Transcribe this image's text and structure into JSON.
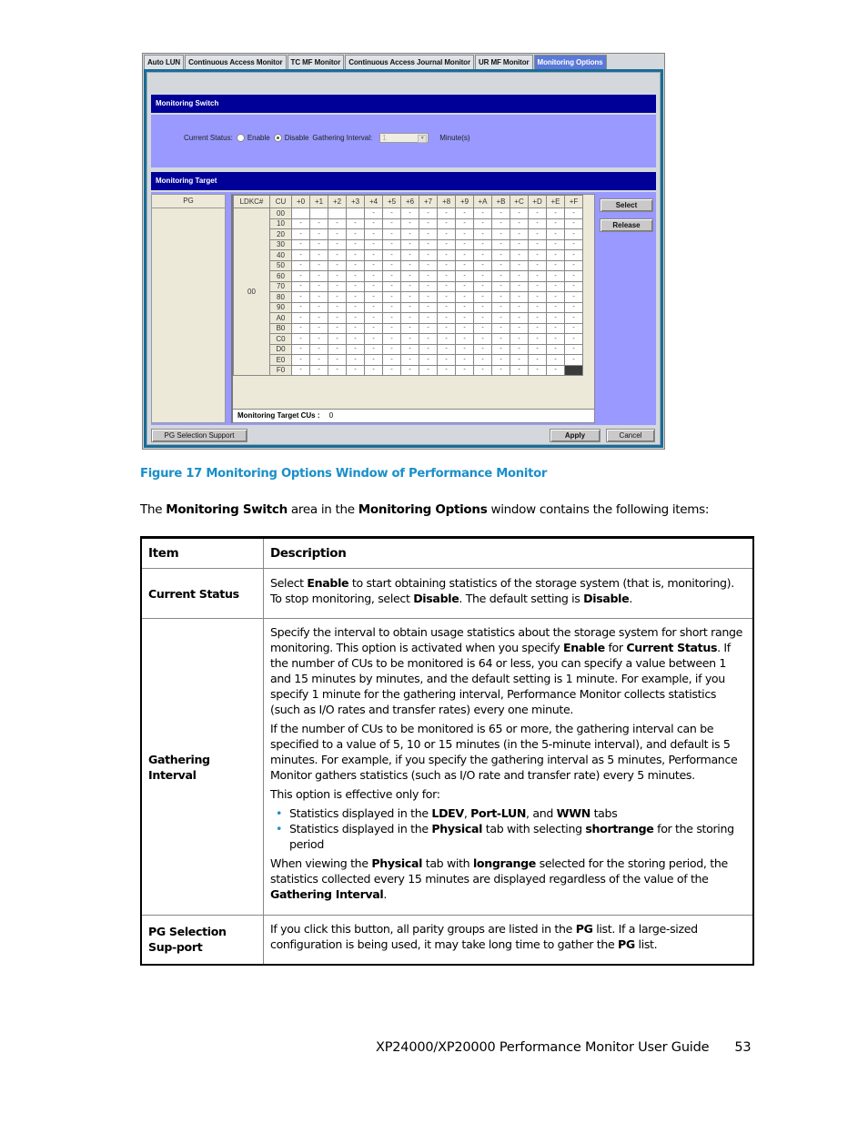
{
  "window": {
    "tabs": [
      {
        "label": "Auto LUN",
        "active": false
      },
      {
        "label": "Continuous Access Monitor",
        "active": false
      },
      {
        "label": "TC MF Monitor",
        "active": false
      },
      {
        "label": "Continuous Access Journal Monitor",
        "active": false
      },
      {
        "label": "UR MF Monitor",
        "active": false
      },
      {
        "label": "Monitoring Options",
        "active": true
      }
    ],
    "monitoring_switch": {
      "title": "Monitoring Switch",
      "current_status_label": "Current Status:",
      "enable_label": "Enable",
      "disable_label": "Disable",
      "selected": "Disable",
      "gathering_interval_label": "Gathering Interval:",
      "gathering_interval_value": "1",
      "minutes_label": "Minute(s)"
    },
    "monitoring_target": {
      "title": "Monitoring Target",
      "pg_header": "PG",
      "ldkc_header": "LDKC#",
      "cu_header": "CU",
      "ldkc_value": "00",
      "columns": [
        "+0",
        "+1",
        "+2",
        "+3",
        "+4",
        "+5",
        "+6",
        "+7",
        "+8",
        "+9",
        "+A",
        "+B",
        "+C",
        "+D",
        "+E",
        "+F"
      ],
      "rows": [
        {
          "cu": "00",
          "cells": [
            "",
            "",
            "",
            "",
            "-",
            "-",
            "-",
            "-",
            "-",
            "-",
            "-",
            "-",
            "-",
            "-",
            "-",
            "-"
          ]
        },
        {
          "cu": "10",
          "cells": [
            "-",
            "-",
            "-",
            "-",
            "-",
            "-",
            "-",
            "-",
            "-",
            "-",
            "-",
            "-",
            "-",
            "-",
            "-",
            "-"
          ]
        },
        {
          "cu": "20",
          "cells": [
            "-",
            "-",
            "-",
            "-",
            "-",
            "-",
            "-",
            "-",
            "-",
            "-",
            "-",
            "-",
            "-",
            "-",
            "-",
            "-"
          ]
        },
        {
          "cu": "30",
          "cells": [
            "-",
            "-",
            "-",
            "-",
            "-",
            "-",
            "-",
            "-",
            "-",
            "-",
            "-",
            "-",
            "-",
            "-",
            "-",
            "-"
          ]
        },
        {
          "cu": "40",
          "cells": [
            "-",
            "-",
            "-",
            "-",
            "-",
            "-",
            "-",
            "-",
            "-",
            "-",
            "-",
            "-",
            "-",
            "-",
            "-",
            "-"
          ]
        },
        {
          "cu": "50",
          "cells": [
            "-",
            "-",
            "-",
            "-",
            "-",
            "-",
            "-",
            "-",
            "-",
            "-",
            "-",
            "-",
            "-",
            "-",
            "-",
            "-"
          ]
        },
        {
          "cu": "60",
          "cells": [
            "-",
            "-",
            "-",
            "-",
            "-",
            "-",
            "-",
            "-",
            "-",
            "-",
            "-",
            "-",
            "-",
            "-",
            "-",
            "-"
          ]
        },
        {
          "cu": "70",
          "cells": [
            "-",
            "-",
            "-",
            "-",
            "-",
            "-",
            "-",
            "-",
            "-",
            "-",
            "-",
            "-",
            "-",
            "-",
            "-",
            "-"
          ]
        },
        {
          "cu": "80",
          "cells": [
            "-",
            "-",
            "-",
            "-",
            "-",
            "-",
            "-",
            "-",
            "-",
            "-",
            "-",
            "-",
            "-",
            "-",
            "-",
            "-"
          ]
        },
        {
          "cu": "90",
          "cells": [
            "-",
            "-",
            "-",
            "-",
            "-",
            "-",
            "-",
            "-",
            "-",
            "-",
            "-",
            "-",
            "-",
            "-",
            "-",
            "-"
          ]
        },
        {
          "cu": "A0",
          "cells": [
            "-",
            "-",
            "-",
            "-",
            "-",
            "-",
            "-",
            "-",
            "-",
            "-",
            "-",
            "-",
            "-",
            "-",
            "-",
            "-"
          ]
        },
        {
          "cu": "B0",
          "cells": [
            "-",
            "-",
            "-",
            "-",
            "-",
            "-",
            "-",
            "-",
            "-",
            "-",
            "-",
            "-",
            "-",
            "-",
            "-",
            "-"
          ]
        },
        {
          "cu": "C0",
          "cells": [
            "-",
            "-",
            "-",
            "-",
            "-",
            "-",
            "-",
            "-",
            "-",
            "-",
            "-",
            "-",
            "-",
            "-",
            "-",
            "-"
          ]
        },
        {
          "cu": "D0",
          "cells": [
            "-",
            "-",
            "-",
            "-",
            "-",
            "-",
            "-",
            "-",
            "-",
            "-",
            "-",
            "-",
            "-",
            "-",
            "-",
            "-"
          ]
        },
        {
          "cu": "E0",
          "cells": [
            "-",
            "-",
            "-",
            "-",
            "-",
            "-",
            "-",
            "-",
            "-",
            "-",
            "-",
            "-",
            "-",
            "-",
            "-",
            "-"
          ]
        },
        {
          "cu": "F0",
          "cells": [
            "-",
            "-",
            "-",
            "-",
            "-",
            "-",
            "-",
            "-",
            "-",
            "-",
            "-",
            "-",
            "-",
            "-",
            "-",
            "#"
          ]
        }
      ],
      "target_cus_label": "Monitoring Target CUs :",
      "target_cus_value": "0",
      "select_button": "Select",
      "release_button": "Release"
    },
    "bottom": {
      "pg_selection_support_button": "PG Selection Support",
      "apply_button": "Apply",
      "cancel_button": "Cancel"
    },
    "colors": {
      "header_navy": "#000099",
      "panel_lavender": "#9999ff",
      "active_tab": "#5b79d6",
      "frame_teal": "#1b6c94"
    }
  },
  "caption": "Figure 17 Monitoring Options Window of Performance Monitor",
  "intro": {
    "t1": "The ",
    "b1": "Monitoring Switch",
    "t2": " area in the ",
    "b2": "Monitoring Options",
    "t3": " window contains the following items:"
  },
  "table": {
    "headers": [
      "Item",
      "Description"
    ],
    "rows": {
      "current_status": {
        "item": "Current Status",
        "p1": {
          "t1": "Select ",
          "b1": "Enable",
          "t2": " to start obtaining statistics of the storage system (that is, monitoring). To stop monitoring, select ",
          "b2": "Disable",
          "t3": ". The default setting is ",
          "b3": "Disable",
          "t4": "."
        }
      },
      "gathering_interval": {
        "item": "Gathering Interval",
        "p1": {
          "t1": "Specify the interval to obtain usage statistics about the storage system for short range monitoring. This option is activated when you specify ",
          "b1": "Enable",
          "t2": " for ",
          "b2": "Current Status",
          "t3": ". If the number of CUs to be monitored is 64 or less, you can specify a value between 1 and 15 minutes by minutes, and the default setting is 1 minute. For example, if you specify 1 minute for the gathering interval, Performance Monitor collects statistics (such as I/O rates and transfer rates) every one minute."
        },
        "p2": "If the number of CUs to be monitored is 65 or more, the gathering interval can be specified to a value of 5, 10 or 15 minutes (in the 5-minute interval), and default is 5 minutes. For example, if you specify the gathering interval as 5 minutes, Performance Monitor gathers statistics (such as I/O rate and transfer rate) every 5 minutes.",
        "p3": "This option is effective only for:",
        "bullet1": {
          "t1": "Statistics displayed in the ",
          "b1": "LDEV",
          "t2": ", ",
          "b2": "Port-LUN",
          "t3": ", and ",
          "b3": "WWN",
          "t4": " tabs"
        },
        "bullet2": {
          "t1": "Statistics displayed in the ",
          "b1": "Physical",
          "t2": " tab with selecting ",
          "b2": "shortrange",
          "t3": " for the storing period"
        },
        "p4": {
          "t1": "When viewing the ",
          "b1": "Physical",
          "t2": " tab with ",
          "b2": "longrange",
          "t3": " selected for the storing period, the statistics collected every 15 minutes are displayed regardless of the value of the ",
          "b3": "Gathering Interval",
          "t4": "."
        }
      },
      "pg_selection_support": {
        "item": "PG Selection Sup-port",
        "p1": {
          "t1": "If you click this button, all parity groups are listed in the ",
          "b1": "PG",
          "t2": " list. If a large-sized configuration is being used, it may take long time to gather the ",
          "b2": "PG",
          "t3": " list."
        }
      }
    }
  },
  "footer": {
    "title": "XP24000/XP20000 Performance Monitor User Guide",
    "page": "53"
  }
}
